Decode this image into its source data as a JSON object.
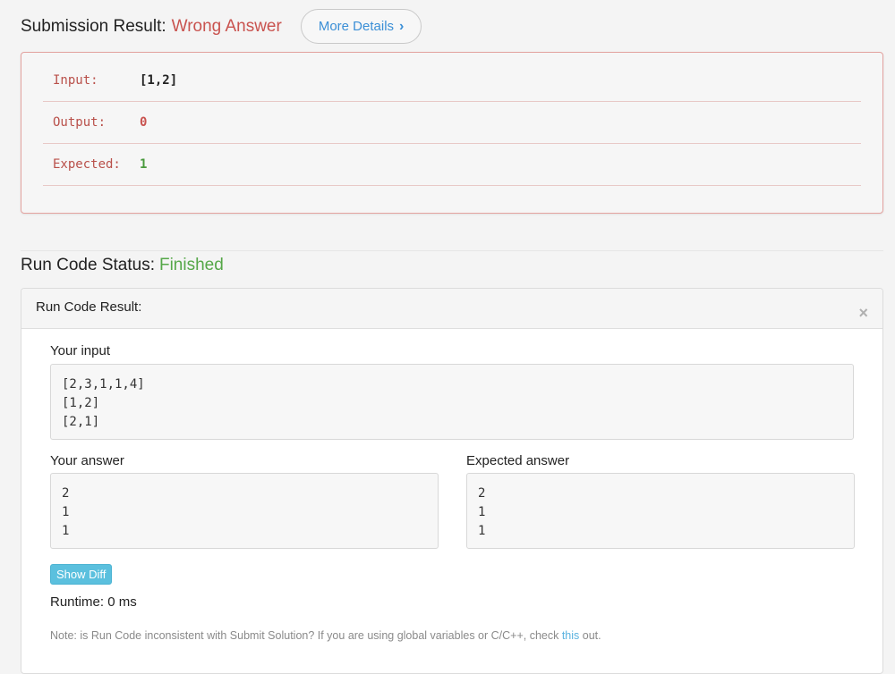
{
  "submission": {
    "label": "Submission Result:",
    "status": "Wrong Answer",
    "more_details": "More Details"
  },
  "result": {
    "rows": [
      {
        "label": "Input:",
        "value": "[1,2]"
      },
      {
        "label": "Output:",
        "value": "0"
      },
      {
        "label": "Expected:",
        "value": "1"
      }
    ]
  },
  "run_status": {
    "label": "Run Code Status:",
    "status": "Finished"
  },
  "run_result": {
    "title": "Run Code Result:",
    "close_symbol": "×",
    "your_input_label": "Your input",
    "your_input": "[2,3,1,1,4]\n[1,2]\n[2,1]",
    "your_answer_label": "Your answer",
    "your_answer": "2\n1\n1",
    "expected_answer_label": "Expected answer",
    "expected_answer": "2\n1\n1",
    "show_diff": "Show Diff",
    "runtime": "Runtime: 0 ms",
    "note_text": "Note: is Run Code inconsistent with Submit Solution? If you are using global variables or C/C++, check ",
    "note_link": "this",
    "note_end": " out."
  },
  "colors": {
    "wrong": "#c9534f",
    "finished": "#55a748",
    "expected_value": "#4a9a3d",
    "link": "#3b8fd6"
  }
}
